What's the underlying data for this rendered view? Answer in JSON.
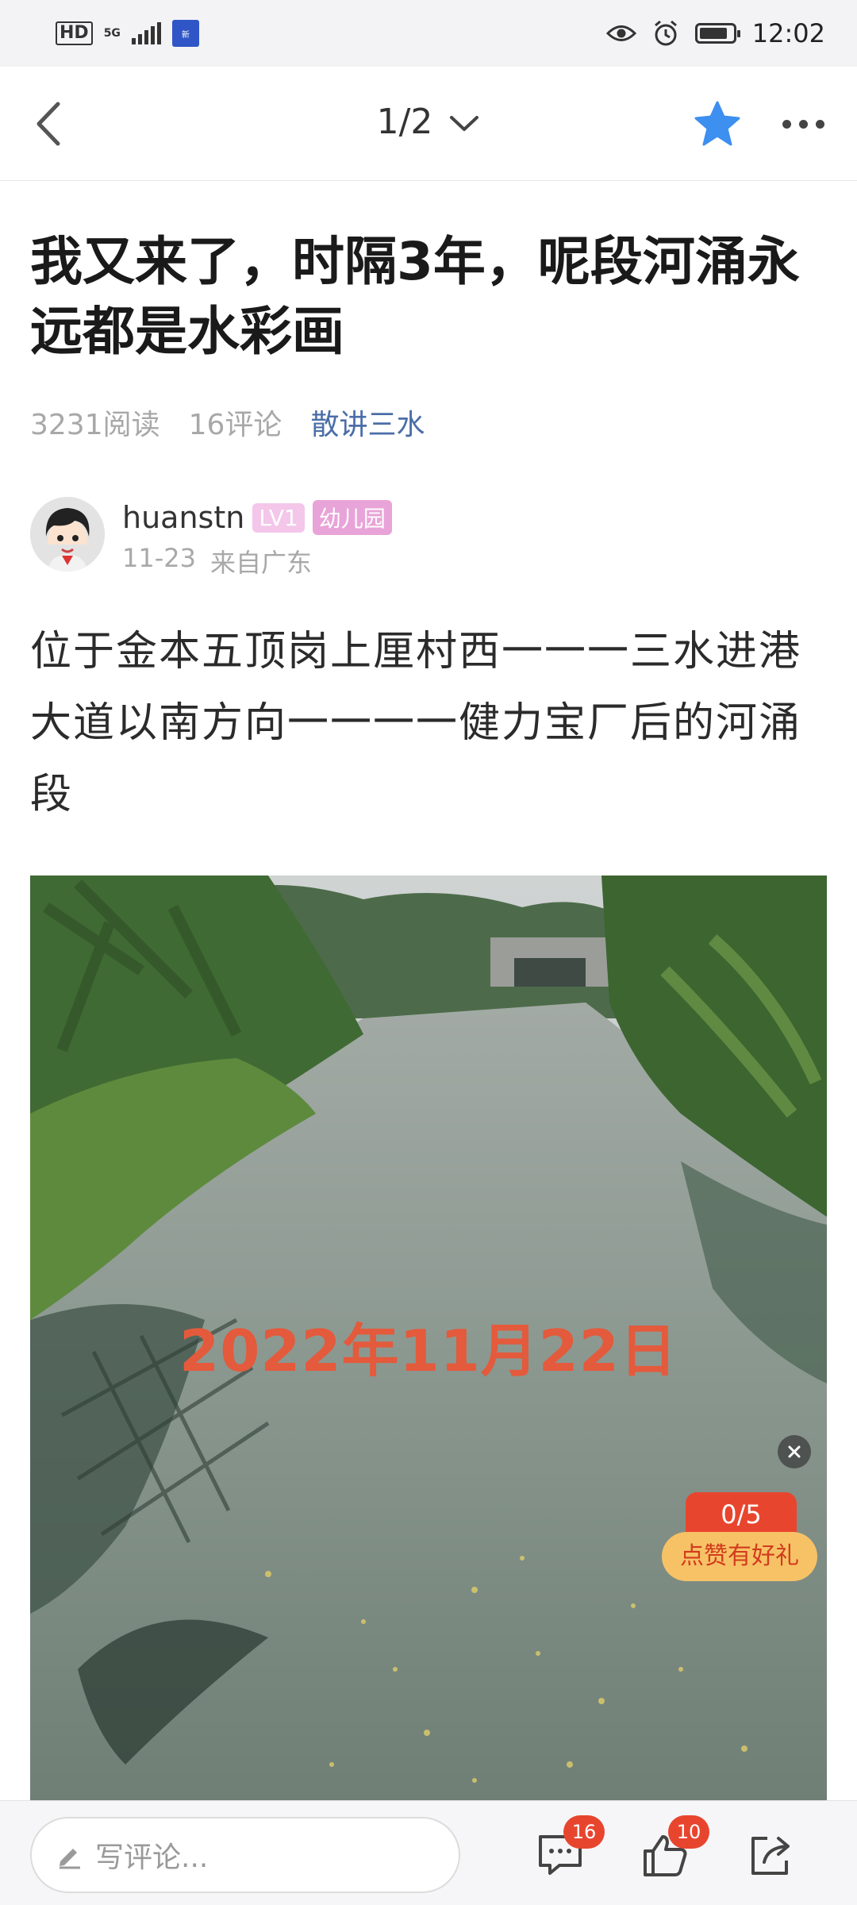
{
  "status_bar": {
    "hd_label": "HD",
    "network_label": "5G",
    "time": "12:02",
    "battery_level": 0.85
  },
  "nav": {
    "page_indicator": "1/2"
  },
  "article": {
    "title": "我又来了，时隔3年，呢段河涌永远都是水彩画",
    "reads": "3231阅读",
    "comments": "16评论",
    "section_tag": "散讲三水",
    "author": {
      "name": "huanstn",
      "level_badge": "LV1",
      "grade_badge": "幼儿园",
      "date": "11-23",
      "location": "来自广东"
    },
    "body": "位于金本五顶岗上厘村西一一一三水进港大道以南方向一一一一健力宝厂后的河涌段",
    "photo_caption": "2022年11月22日"
  },
  "promo": {
    "count": "0/5",
    "label": "点赞有好礼"
  },
  "bottom_bar": {
    "comment_placeholder": "写评论...",
    "comment_count": "16",
    "like_count": "10"
  },
  "colors": {
    "accent_blue": "#3d8ff0",
    "tag_blue": "#4b6ea8",
    "badge_red": "#e8452f",
    "caption_orange": "#e45a3c"
  },
  "icons": [
    "back-arrow-icon",
    "chevron-down-icon",
    "star-icon",
    "more-icon",
    "pencil-icon",
    "comment-icon",
    "thumbs-up-icon",
    "share-icon",
    "close-icon",
    "eye-icon",
    "alarm-icon",
    "battery-icon",
    "signal-icon"
  ]
}
